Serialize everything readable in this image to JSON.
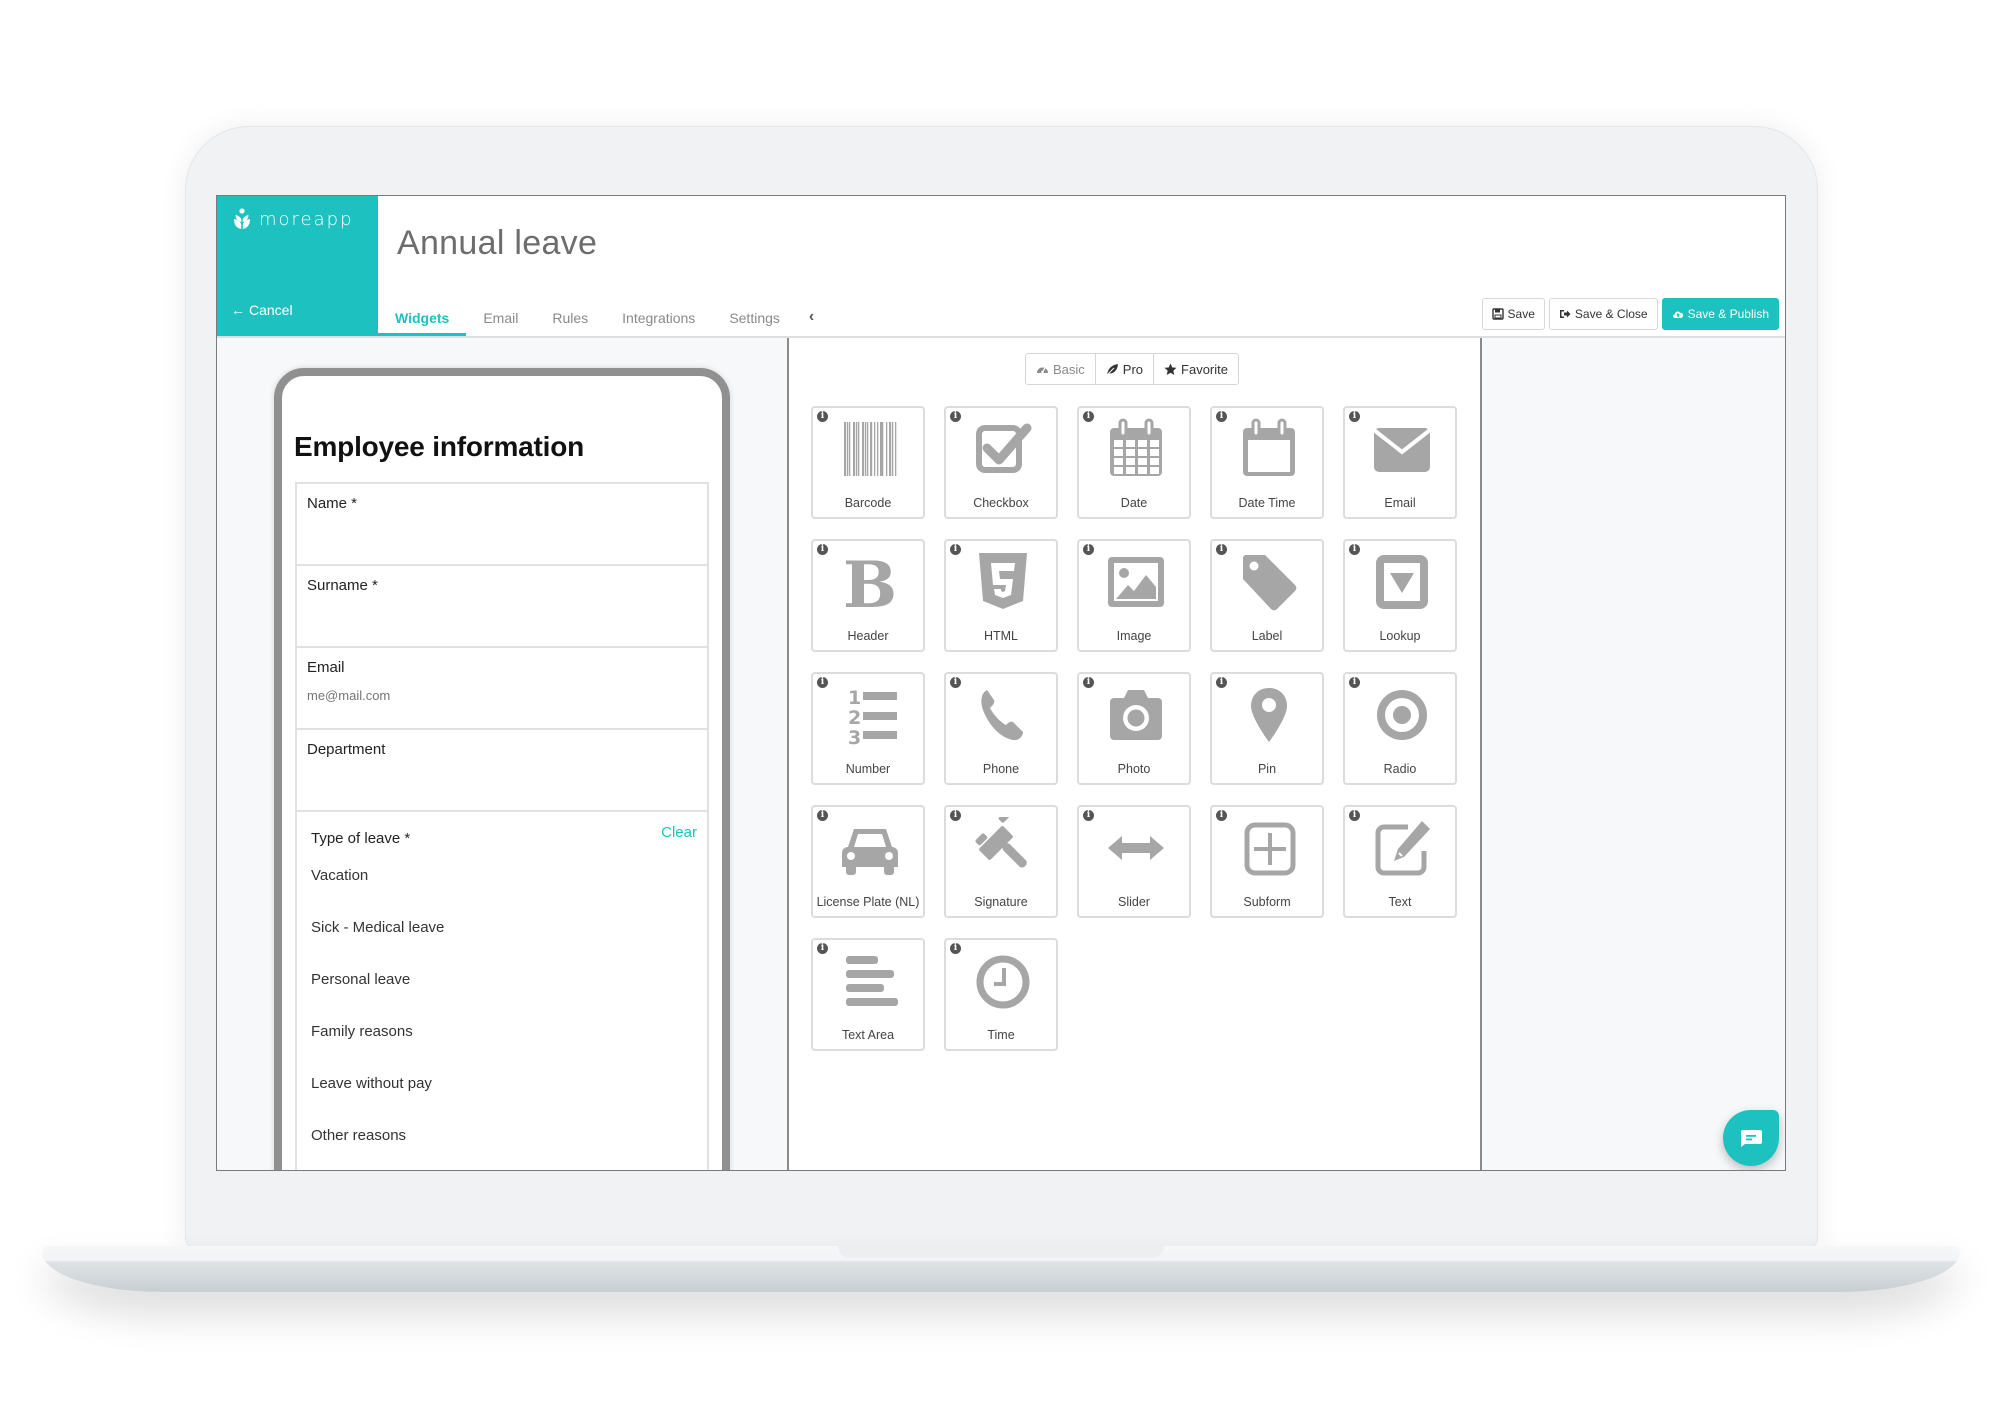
{
  "brand": {
    "name": "moreapp",
    "cancel_label": "Cancel"
  },
  "header": {
    "title": "Annual leave",
    "tabs": [
      {
        "label": "Widgets",
        "active": true
      },
      {
        "label": "Email",
        "active": false
      },
      {
        "label": "Rules",
        "active": false
      },
      {
        "label": "Integrations",
        "active": false
      },
      {
        "label": "Settings",
        "active": false
      }
    ],
    "collapse_icon": "chevron-left-icon",
    "actions": {
      "save": "Save",
      "save_close": "Save & Close",
      "save_publish": "Save & Publish"
    }
  },
  "preview": {
    "form_title": "Employee information",
    "fields": [
      {
        "label": "Name *",
        "value": "",
        "placeholder": ""
      },
      {
        "label": "Surname *",
        "value": "",
        "placeholder": ""
      },
      {
        "label": "Email",
        "value": "",
        "placeholder": "me@mail.com"
      },
      {
        "label": "Department",
        "value": "",
        "placeholder": ""
      }
    ],
    "radio": {
      "label": "Type of leave *",
      "clear_label": "Clear",
      "options": [
        "Vacation",
        "Sick - Medical leave",
        "Personal leave",
        "Family reasons",
        "Leave without pay",
        "Other reasons"
      ]
    }
  },
  "widget_panel": {
    "categories": [
      {
        "label": "Basic",
        "icon": "dashboard-icon",
        "active": false
      },
      {
        "label": "Pro",
        "icon": "leaf-icon",
        "active": true
      },
      {
        "label": "Favorite",
        "icon": "star-icon",
        "active": true
      }
    ],
    "widgets": [
      {
        "label": "Barcode",
        "icon": "barcode"
      },
      {
        "label": "Checkbox",
        "icon": "checkbox"
      },
      {
        "label": "Date",
        "icon": "calendar"
      },
      {
        "label": "Date Time",
        "icon": "calendar-blank"
      },
      {
        "label": "Email",
        "icon": "envelope"
      },
      {
        "label": "Header",
        "icon": "bold"
      },
      {
        "label": "HTML",
        "icon": "html5"
      },
      {
        "label": "Image",
        "icon": "image"
      },
      {
        "label": "Label",
        "icon": "tag"
      },
      {
        "label": "Lookup",
        "icon": "dropdown"
      },
      {
        "label": "Number",
        "icon": "numbered-list"
      },
      {
        "label": "Phone",
        "icon": "phone"
      },
      {
        "label": "Photo",
        "icon": "camera"
      },
      {
        "label": "Pin",
        "icon": "map-pin"
      },
      {
        "label": "Radio",
        "icon": "radio"
      },
      {
        "label": "License Plate (NL)",
        "icon": "car"
      },
      {
        "label": "Signature",
        "icon": "gavel"
      },
      {
        "label": "Slider",
        "icon": "arrows-horizontal"
      },
      {
        "label": "Subform",
        "icon": "plus-square"
      },
      {
        "label": "Text",
        "icon": "edit"
      },
      {
        "label": "Text Area",
        "icon": "text-lines"
      },
      {
        "label": "Time",
        "icon": "clock"
      }
    ],
    "info_glyph": "i"
  },
  "chat": {
    "icon": "chat-icon"
  },
  "colors": {
    "accent": "#1dc2c0",
    "icon_gray": "#a6a6a6"
  }
}
